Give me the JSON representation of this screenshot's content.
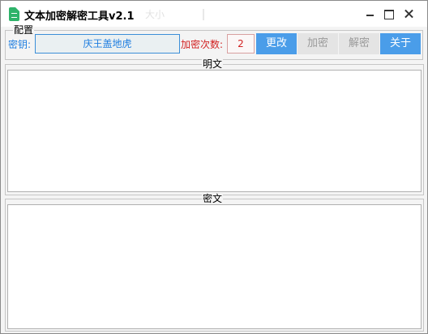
{
  "window": {
    "title": "文本加密解密工具v2.1",
    "ghost_text": "大小"
  },
  "config": {
    "legend": "配置",
    "key_label": "密钥:",
    "key_value": "庆王盖地虎",
    "count_label": "加密次数:",
    "count_value": "2",
    "buttons": {
      "change": "更改",
      "encrypt": "加密",
      "decrypt": "解密",
      "about": "关于"
    }
  },
  "plaintext": {
    "legend": "明文",
    "value": ""
  },
  "ciphertext": {
    "legend": "密文",
    "value": ""
  },
  "colors": {
    "accent_blue": "#4a9de9",
    "key_text": "#1f7ee0",
    "count_text": "#d22222",
    "disabled_bg": "#e4e4e4",
    "app_icon": "#2fb36a"
  },
  "icons": {
    "app": "document-lock-icon",
    "minimize": "minimize-icon",
    "maximize": "maximize-icon",
    "close": "close-icon"
  }
}
